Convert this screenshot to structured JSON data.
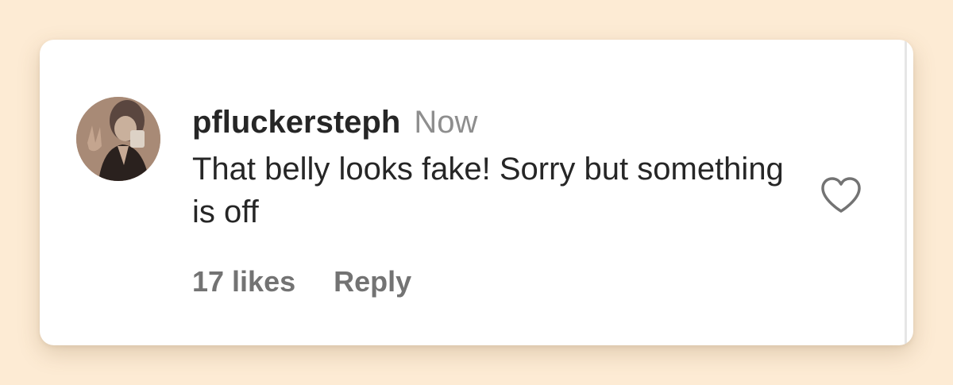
{
  "comment": {
    "username": "pfluckersteph",
    "timestamp": "Now",
    "text": "That belly looks fake! Sorry but something is off",
    "likes_label": "17 likes",
    "reply_label": "Reply",
    "like_icon": "heart-outline-icon"
  },
  "colors": {
    "background": "#fdebd4",
    "card": "#ffffff",
    "text_primary": "#262626",
    "text_secondary": "#8e8e8e",
    "action_text": "#737373"
  }
}
